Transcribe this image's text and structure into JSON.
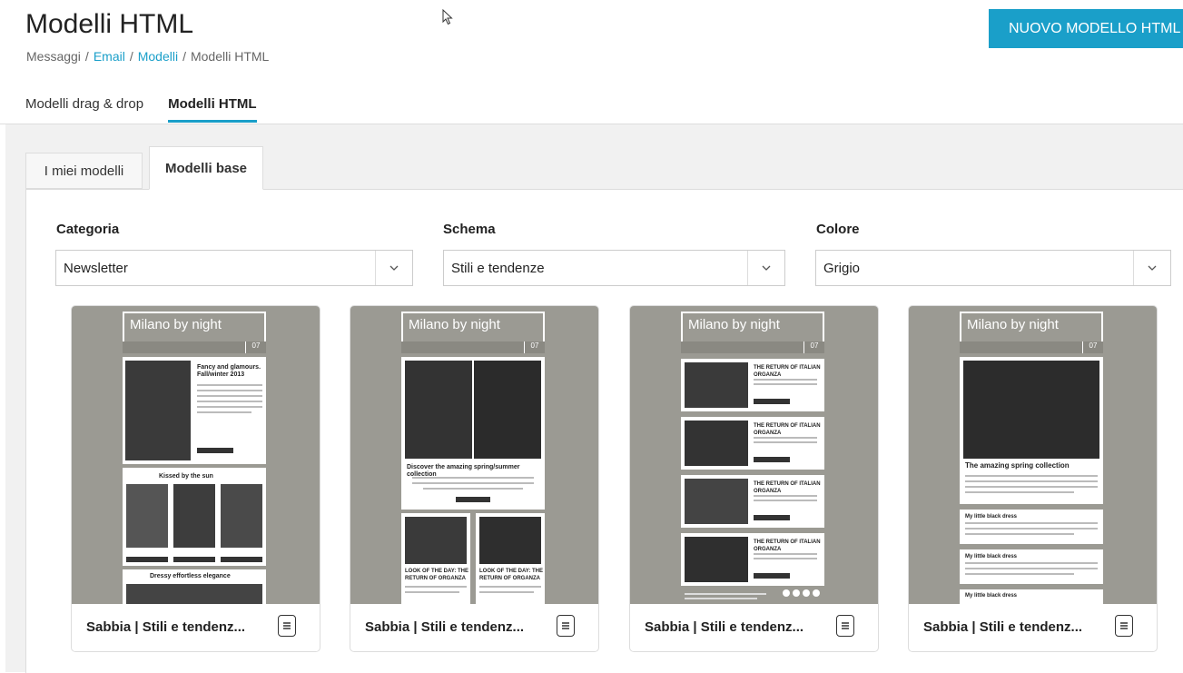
{
  "page": {
    "title": "Modelli HTML",
    "new_button": "NUOVO MODELLO HTML"
  },
  "breadcrumb": {
    "items": [
      "Messaggi",
      "Email",
      "Modelli",
      "Modelli HTML"
    ]
  },
  "top_tabs": [
    "Modelli drag & drop",
    "Modelli HTML"
  ],
  "sub_tabs": [
    "I miei modelli",
    "Modelli base"
  ],
  "filters": {
    "category": {
      "label": "Categoria",
      "value": "Newsletter"
    },
    "schema": {
      "label": "Schema",
      "value": "Stili e tendenze"
    },
    "color": {
      "label": "Colore",
      "value": "Grigio"
    }
  },
  "cards": [
    {
      "name": "Sabbia | Stili e tendenz...",
      "preview_title": "Milano by night",
      "preview_number": "07"
    },
    {
      "name": "Sabbia | Stili e tendenz...",
      "preview_title": "Milano by night",
      "preview_number": "07"
    },
    {
      "name": "Sabbia | Stili e tendenz...",
      "preview_title": "Milano by night",
      "preview_number": "07"
    },
    {
      "name": "Sabbia | Stili e tendenz...",
      "preview_title": "Milano by night",
      "preview_number": "07"
    }
  ],
  "previews": {
    "p1_heading": "Fancy and glamours. Fall/winter 2013",
    "p1_section": "Kissed by the sun",
    "p1_section2": "Dressy effortless elegance",
    "p2_heading": "Discover the amazing spring/summer collection",
    "p2_col1": "LOOK OF THE DAY: THE RETURN OF ORGANZA",
    "p2_col2": "LOOK OF THE DAY: THE RETURN OF ORGANZA",
    "p3_item": "THE RETURN OF ITALIAN ORGANZA",
    "p4_heading": "The amazing spring collection",
    "p4_item": "My little black dress"
  },
  "colors": {
    "accent": "#1a9fc9",
    "thumb_bg": "#9b9a93"
  }
}
